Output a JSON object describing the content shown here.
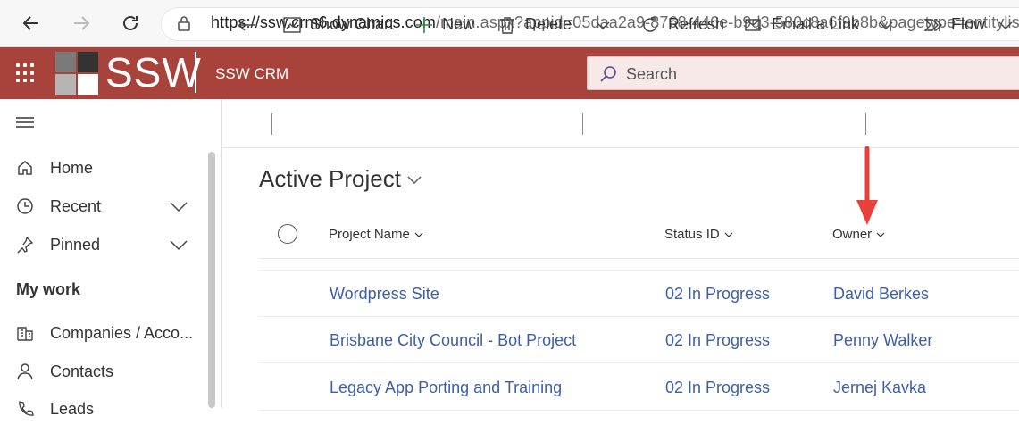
{
  "browser": {
    "url_host": "https://ssw.crm6.dynamics.com",
    "url_path": "/main.aspx?appid=05daa2a9-8768-446e-b9d3-580c8a6f9b8b&pagetype=entitylist&et"
  },
  "header": {
    "logo_text": "SSW",
    "app_title": "SSW CRM",
    "search_placeholder": "Search",
    "brand_color": "#a8433b"
  },
  "sidebar": {
    "items_top": [
      {
        "label": "Home",
        "icon": "home-icon"
      },
      {
        "label": "Recent",
        "icon": "clock-icon"
      },
      {
        "label": "Pinned",
        "icon": "pin-icon"
      }
    ],
    "section_title": "My work",
    "items_work": [
      {
        "label": "Companies / Acco...",
        "icon": "building-icon"
      },
      {
        "label": "Contacts",
        "icon": "person-icon"
      },
      {
        "label": "Leads",
        "icon": "phone-icon"
      }
    ]
  },
  "commands": {
    "show_chart": "Show Chart",
    "new": "New",
    "delete": "Delete",
    "refresh": "Refresh",
    "email_link": "Email a Link",
    "flow": "Flow"
  },
  "view": {
    "title": "Active Project"
  },
  "grid": {
    "columns": [
      "Project Name",
      "Status ID",
      "Owner"
    ],
    "rows": [
      [
        "Wordpress Site",
        "02 In Progress",
        "David Berkes"
      ],
      [
        "Brisbane City Council - Bot Project",
        "02 In Progress",
        "Penny Walker"
      ],
      [
        "Legacy App Porting and Training",
        "02 In Progress",
        "Jernej Kavka"
      ]
    ]
  },
  "annotation": {
    "arrow_color": "#e8413c"
  }
}
